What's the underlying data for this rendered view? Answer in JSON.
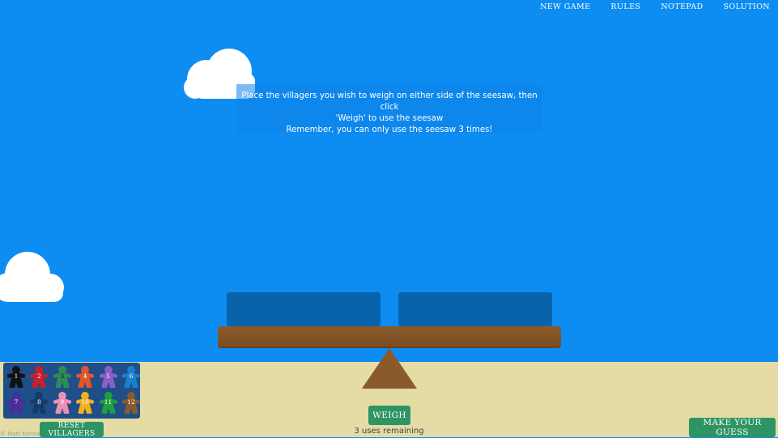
{
  "nav": {
    "items": [
      {
        "label": "NEW GAME"
      },
      {
        "label": "RULES"
      },
      {
        "label": "NOTEPAD"
      },
      {
        "label": "SOLUTION"
      }
    ]
  },
  "instructions": {
    "line1": "Place the villagers you wish to weigh on either side of the seesaw, then click",
    "line2": "'Weigh' to use the seesaw",
    "line3": "Remember, you can only use the seesaw 3 times!"
  },
  "villagers": [
    {
      "number": "1",
      "color": "#111111",
      "text_color": "#ffffff"
    },
    {
      "number": "2",
      "color": "#c8202a",
      "text_color": "#ffffff"
    },
    {
      "number": "3",
      "color": "#2f8a5a",
      "text_color": "#111111"
    },
    {
      "number": "4",
      "color": "#e4552a",
      "text_color": "#ffffff"
    },
    {
      "number": "5",
      "color": "#8a5fc4",
      "text_color": "#ffffff"
    },
    {
      "number": "6",
      "color": "#1b7fd0",
      "text_color": "#ffffff"
    },
    {
      "number": "7",
      "color": "#4a2c9c",
      "text_color": "#ffffff"
    },
    {
      "number": "8",
      "color": "#163a6c",
      "text_color": "#ffffff"
    },
    {
      "number": "9",
      "color": "#ef8fb4",
      "text_color": "#ffffff"
    },
    {
      "number": "10",
      "color": "#f2b01e",
      "text_color": "#ffffff"
    },
    {
      "number": "11",
      "color": "#1ea13a",
      "text_color": "#ffffff"
    },
    {
      "number": "12",
      "color": "#8b5a2b",
      "text_color": "#ffffff"
    }
  ],
  "buttons": {
    "reset": "RESET VILLAGERS",
    "weigh": "WEIGH",
    "guess": "MAKE YOUR GUESS"
  },
  "status": {
    "uses_remaining": "3 uses remaining"
  },
  "footer": {
    "copyright": "© Matt Kenna"
  },
  "colors": {
    "sky": "#0d8cf2",
    "ground": "#e4dca4",
    "pan": "#0863aa",
    "beam": "#8a5a2b",
    "button": "#2e9464",
    "tray": "#1f4e88"
  }
}
